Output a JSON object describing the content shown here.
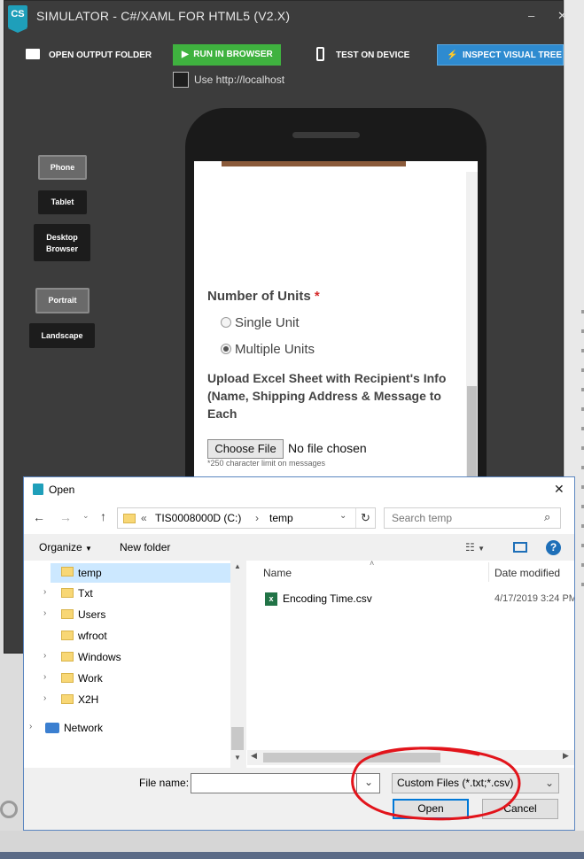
{
  "simulator": {
    "logo": "CS",
    "title": "SIMULATOR - C#/XAML FOR HTML5 (V2.X)",
    "minimize": "–",
    "close": "✕",
    "toolbar": {
      "open_output_folder": "OPEN OUTPUT FOLDER",
      "run_in_browser": "RUN IN BROWSER",
      "test_on_device": "TEST ON DEVICE",
      "inspect_visual_tree": "INSPECT VISUAL TREE",
      "use_localhost": "Use http://localhost"
    },
    "side_buttons": {
      "phone": "Phone",
      "tablet": "Tablet",
      "desktop_browser_1": "Desktop",
      "desktop_browser_2": "Browser",
      "portrait": "Portrait",
      "landscape": "Landscape"
    },
    "form": {
      "units_label": "Number of Units",
      "required": "*",
      "single_unit": "Single Unit",
      "multiple_units": "Multiple Units",
      "upload_line1": "Upload Excel Sheet with Recipient's Info",
      "upload_line2": "(Name, Shipping Address & Message to",
      "upload_line3": "Each",
      "choose_file": "Choose File",
      "no_file": "No file chosen",
      "limit_note": "*250 character limit on messages"
    }
  },
  "dialog": {
    "title": "Open",
    "close": "✕",
    "breadcrumb": {
      "prefix": "«",
      "drive": "TIS0008000D (C:)",
      "sep": "›",
      "folder": "temp"
    },
    "search_placeholder": "Search temp",
    "organize": "Organize",
    "new_folder": "New folder",
    "nav_items": [
      {
        "label": "temp"
      },
      {
        "label": "Txt"
      },
      {
        "label": "Users"
      },
      {
        "label": "wfroot"
      },
      {
        "label": "Windows"
      },
      {
        "label": "Work"
      },
      {
        "label": "X2H"
      },
      {
        "label": "Network"
      }
    ],
    "columns": {
      "name": "Name",
      "date_modified": "Date modified"
    },
    "files": [
      {
        "name": "Encoding Time.csv",
        "date": "4/17/2019 3:24 PM"
      }
    ],
    "file_name_label": "File name:",
    "file_name_value": "",
    "filter": "Custom Files (*.txt;*.csv)",
    "open_button": "Open",
    "cancel_button": "Cancel"
  }
}
